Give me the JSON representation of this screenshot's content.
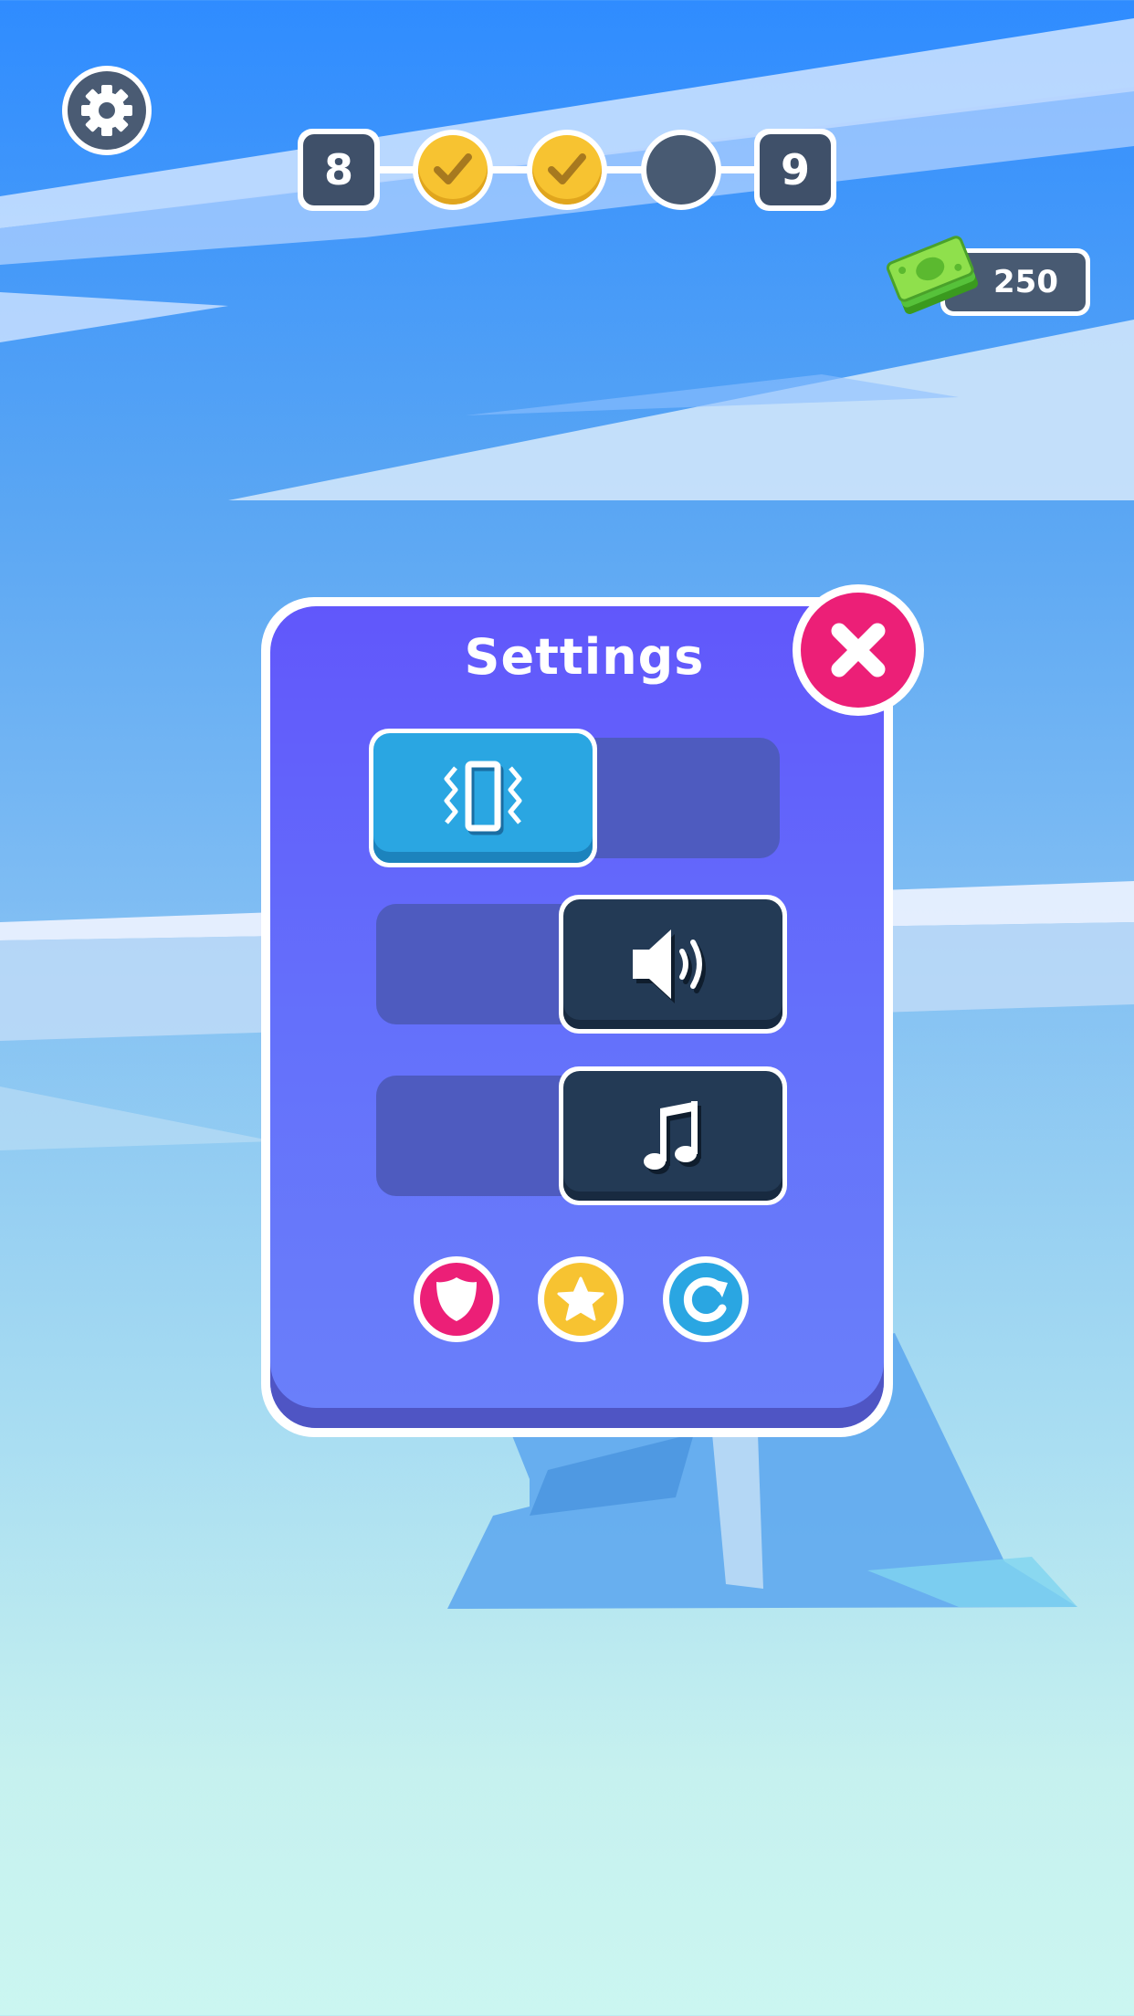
{
  "hud": {
    "level_from": "8",
    "level_to": "9",
    "stages": [
      {
        "state": "done",
        "icon": "check-icon"
      },
      {
        "state": "done",
        "icon": "check-icon"
      },
      {
        "state": "current",
        "icon": ""
      }
    ],
    "cash_amount": "250",
    "cash_icon": "cash-stack-icon",
    "settings_icon": "gear-icon"
  },
  "settings_panel": {
    "title": "Settings",
    "close_icon": "close-x-icon",
    "toggles": [
      {
        "name": "vibration",
        "icon": "vibration-icon",
        "state": "on"
      },
      {
        "name": "sound",
        "icon": "speaker-icon",
        "state": "off"
      },
      {
        "name": "music",
        "icon": "music-note-icon",
        "state": "off"
      }
    ],
    "bottom_buttons": [
      {
        "name": "privacy",
        "icon": "shield-icon",
        "color": "#ec1f77"
      },
      {
        "name": "rate",
        "icon": "star-icon",
        "color": "#f7c331"
      },
      {
        "name": "restore",
        "icon": "restore-icon",
        "color": "#2aa6e2"
      }
    ]
  },
  "colors": {
    "accent_pink": "#ec1f77",
    "panel_purple": "#6157fb",
    "toggle_on": "#2aa6e2",
    "toggle_off": "#233a55"
  }
}
